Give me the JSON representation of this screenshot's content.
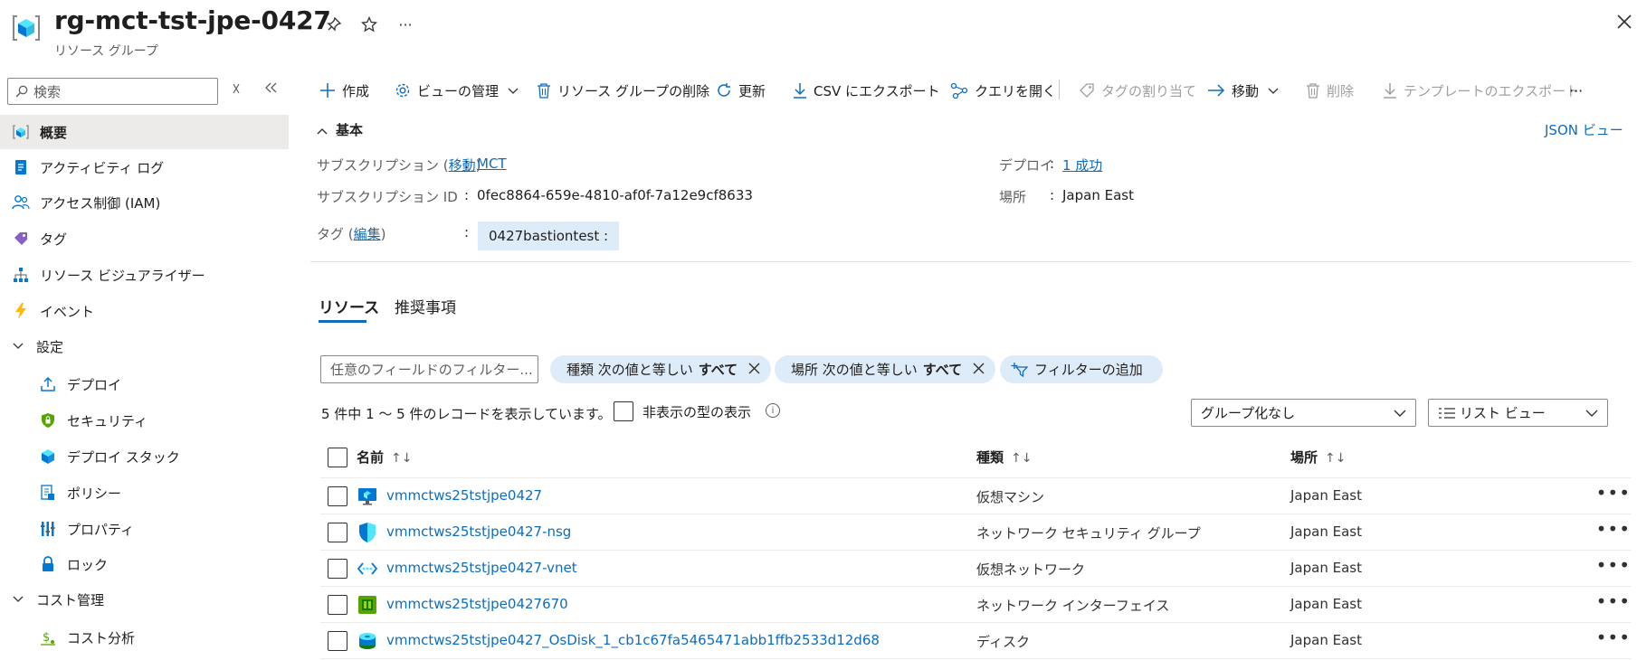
{
  "header": {
    "title": "rg-mct-tst-jpe-0427",
    "subtitle": "リソース グループ",
    "more": "···"
  },
  "nav": {
    "search_placeholder": "検索",
    "items": [
      {
        "label": "概要"
      },
      {
        "label": "アクティビティ ログ"
      },
      {
        "label": "アクセス制御 (IAM)"
      },
      {
        "label": "タグ"
      },
      {
        "label": "リソース ビジュアライザー"
      },
      {
        "label": "イベント"
      },
      {
        "label": "設定"
      },
      {
        "label": "デプロイ"
      },
      {
        "label": "セキュリティ"
      },
      {
        "label": "デプロイ スタック"
      },
      {
        "label": "ポリシー"
      },
      {
        "label": "プロパティ"
      },
      {
        "label": "ロック"
      },
      {
        "label": "コスト管理"
      },
      {
        "label": "コスト分析"
      }
    ]
  },
  "toolbar": {
    "create": "作成",
    "manage_view": "ビューの管理",
    "delete_rg": "リソース グループの削除",
    "refresh": "更新",
    "export_csv": "CSV にエクスポート",
    "open_query": "クエリを開く",
    "assign_tags": "タグの割り当て",
    "move": "移動",
    "delete": "削除",
    "export_template": "テンプレートのエクスポート",
    "more": "···"
  },
  "essentials": {
    "section_title": "基本",
    "json_view": "JSON ビュー",
    "subscription_label_pre": "サブスクリプション (",
    "subscription_move_link": "移動",
    "subscription_label_post": ")",
    "subscription_value": "MCT",
    "subscription_id_label": "サブスクリプション ID",
    "subscription_id_value": "0fec8864-659e-4810-af0f-7a12e9cf8633",
    "tags_label_pre": "タグ (",
    "tags_edit_link": "編集",
    "tags_label_post": ")",
    "tag_value": "0427bastiontest :",
    "deploy_label": "デプロイ",
    "deploy_value": "1 成功",
    "location_label": "場所",
    "location_value": "Japan East",
    "colon": ":"
  },
  "tabs": {
    "resources": "リソース",
    "recommendations": "推奨事項"
  },
  "filters": {
    "input_placeholder": "任意のフィールドのフィルター...",
    "type_pill": {
      "prefix": "種類 次の値と等しい",
      "value": "すべて"
    },
    "location_pill": {
      "prefix": "場所 次の値と等しい",
      "value": "すべて"
    },
    "add_filter": "フィルターの追加"
  },
  "list": {
    "count_text": "5 件中 1 ～ 5 件のレコードを表示しています。",
    "show_hidden": "非表示の型の表示",
    "grouping": "グループ化なし",
    "view": "リスト ビュー",
    "columns": {
      "name": "名前",
      "type": "種類",
      "location": "場所"
    },
    "rows": [
      {
        "name": "vmmctws25tstjpe0427",
        "type": "仮想マシン",
        "location": "Japan East",
        "icon": "vm-icon"
      },
      {
        "name": "vmmctws25tstjpe0427-nsg",
        "type": "ネットワーク セキュリティ グループ",
        "location": "Japan East",
        "icon": "nsg-icon"
      },
      {
        "name": "vmmctws25tstjpe0427-vnet",
        "type": "仮想ネットワーク",
        "location": "Japan East",
        "icon": "vnet-icon"
      },
      {
        "name": "vmmctws25tstjpe0427670",
        "type": "ネットワーク インターフェイス",
        "location": "Japan East",
        "icon": "nic-icon"
      },
      {
        "name": "vmmctws25tstjpe0427_OsDisk_1_cb1c67fa5465471abb1ffb2533d12d68",
        "type": "ディスク",
        "location": "Japan East",
        "icon": "disk-icon"
      }
    ],
    "row_more": "•••"
  },
  "colors": {
    "accent": "#0f6cbd",
    "pill_bg": "#deecf9",
    "selected_nav_bg": "#edebe9"
  }
}
